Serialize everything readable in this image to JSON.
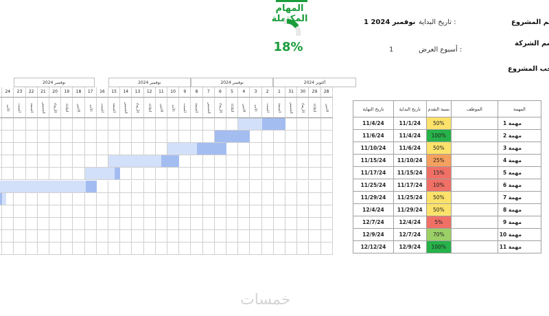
{
  "header": {
    "completed_title": "المهام المكتملة",
    "completed_percent": "18%",
    "start_date_label": "تاريخ البداية :",
    "start_date_value": "1 نوفمبر 2024",
    "display_week_label": "أسبوع العرض :",
    "display_week_value": "1",
    "project_name_label": "اسم المشروع",
    "company_name_label": "اسم الشركة",
    "project_owner_label": "صاحب المشروع"
  },
  "gantt": {
    "months": [
      {
        "label": "نوفمبر 2024",
        "span": 8
      },
      {
        "label": "نوفمبر 2024",
        "span": 7
      },
      {
        "label": "نوفمبر 2024",
        "span": 7
      },
      {
        "label": "أكتوبر 2024",
        "span": 7
      }
    ],
    "days": [
      {
        "num": "25",
        "name": "الاثنين"
      },
      {
        "num": "24",
        "name": "الأحد"
      },
      {
        "num": "23",
        "name": "السبت"
      },
      {
        "num": "22",
        "name": "الجمعة"
      },
      {
        "num": "21",
        "name": "الخميس"
      },
      {
        "num": "20",
        "name": "الأربعاء"
      },
      {
        "num": "19",
        "name": "الثلاثاء"
      },
      {
        "num": "18",
        "name": "الاثنين"
      },
      {
        "num": "17",
        "name": "الأحد"
      },
      {
        "num": "16",
        "name": "السبت"
      },
      {
        "num": "15",
        "name": "الجمعة"
      },
      {
        "num": "14",
        "name": "الخميس"
      },
      {
        "num": "13",
        "name": "الأربعاء"
      },
      {
        "num": "12",
        "name": "الثلاثاء"
      },
      {
        "num": "11",
        "name": "الاثنين"
      },
      {
        "num": "10",
        "name": "الأحد"
      },
      {
        "num": "9",
        "name": "السبت"
      },
      {
        "num": "8",
        "name": "الجمعة"
      },
      {
        "num": "7",
        "name": "الخميس"
      },
      {
        "num": "6",
        "name": "الأربعاء"
      },
      {
        "num": "5",
        "name": "الثلاثاء"
      },
      {
        "num": "4",
        "name": "الاثنين"
      },
      {
        "num": "3",
        "name": "الأحد"
      },
      {
        "num": "2",
        "name": "السبت"
      },
      {
        "num": "1",
        "name": "الجمعة"
      },
      {
        "num": "31",
        "name": "الخميس"
      },
      {
        "num": "30",
        "name": "الأربعاء"
      },
      {
        "num": "29",
        "name": "الثلاثاء"
      },
      {
        "num": "28",
        "name": "الاثنين"
      }
    ]
  },
  "table": {
    "headers": {
      "task": "المهمة",
      "assignee": "الموظف",
      "progress": "نسبة التقدم",
      "start": "تاريخ البداية",
      "end": "تاريخ النهاية"
    },
    "rows": [
      {
        "task": "مهمة 1",
        "assignee": "",
        "progress": "50%",
        "start": "11/1/24",
        "end": "11/4/24"
      },
      {
        "task": "مهمة 2",
        "assignee": "",
        "progress": "100%",
        "start": "11/4/24",
        "end": "11/6/24"
      },
      {
        "task": "مهمة 3",
        "assignee": "",
        "progress": "50%",
        "start": "11/6/24",
        "end": "11/10/24"
      },
      {
        "task": "مهمة 4",
        "assignee": "",
        "progress": "25%",
        "start": "11/10/24",
        "end": "11/15/24"
      },
      {
        "task": "مهمة 5",
        "assignee": "",
        "progress": "15%",
        "start": "11/15/24",
        "end": "11/17/24"
      },
      {
        "task": "مهمة 6",
        "assignee": "",
        "progress": "10%",
        "start": "11/17/24",
        "end": "11/25/24"
      },
      {
        "task": "مهمة 7",
        "assignee": "",
        "progress": "50%",
        "start": "11/25/24",
        "end": "11/29/24"
      },
      {
        "task": "مهمة 8",
        "assignee": "",
        "progress": "50%",
        "start": "11/29/24",
        "end": "12/4/24"
      },
      {
        "task": "مهمة 9",
        "assignee": "",
        "progress": "5%",
        "start": "12/4/24",
        "end": "12/7/24"
      },
      {
        "task": "مهمة 10",
        "assignee": "",
        "progress": "70%",
        "start": "12/7/24",
        "end": "12/9/24"
      },
      {
        "task": "مهمة 11",
        "assignee": "",
        "progress": "100%",
        "start": "12/9/24",
        "end": "12/12/24"
      }
    ]
  },
  "colors": {
    "accent_green": "#1a9c3a",
    "bar_dark": "#a4bdf1",
    "bar_light": "#d3e0f9",
    "progress_high": "#27b24a",
    "progress_mid": "#fce26b",
    "progress_70": "#9bd067",
    "progress_25": "#f5a05e",
    "progress_low": "#f07066"
  },
  "watermark": "خمسات"
}
